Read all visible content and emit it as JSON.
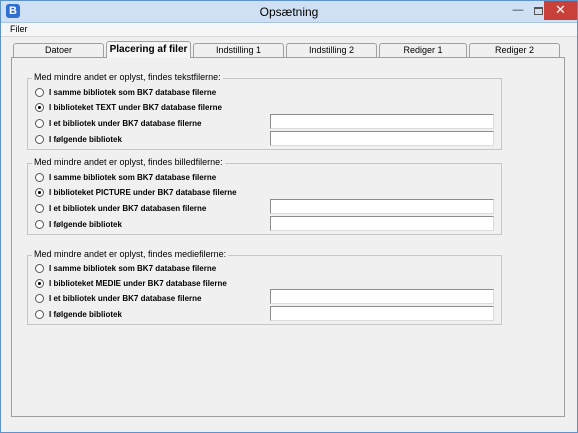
{
  "window": {
    "title": "Opsætning",
    "min_glyph": "—",
    "close_glyph": "✕"
  },
  "menu": [
    {
      "label": "Filer"
    }
  ],
  "tabs": [
    {
      "label": "Datoer",
      "active": false
    },
    {
      "label": "Placering af filer",
      "active": true
    },
    {
      "label": "Indstilling 1",
      "active": false
    },
    {
      "label": "Indstilling 2",
      "active": false
    },
    {
      "label": "Rediger 1",
      "active": false
    },
    {
      "label": "Rediger 2",
      "active": false
    }
  ],
  "groups": [
    {
      "legend": "Med mindre andet er oplyst, findes tekstfilerne:",
      "options": [
        {
          "label": "I samme bibliotek som BK7 database filerne",
          "selected": false
        },
        {
          "label": "I biblioteket TEXT under BK7 database filerne",
          "selected": true
        },
        {
          "label": "I et bibliotek under BK7 database filerne",
          "selected": false,
          "input_value": ""
        },
        {
          "label": "I følgende bibliotek",
          "selected": false,
          "input_value": ""
        }
      ]
    },
    {
      "legend": "Med mindre andet er oplyst, findes billedfilerne:",
      "options": [
        {
          "label": "I samme bibliotek som BK7 database filerne",
          "selected": false
        },
        {
          "label": "I biblioteket PICTURE under BK7 database filerne",
          "selected": true
        },
        {
          "label": "I et bibliotek under BK7 databasen filerne",
          "selected": false,
          "input_value": ""
        },
        {
          "label": "I følgende bibliotek",
          "selected": false,
          "input_value": ""
        }
      ]
    },
    {
      "legend": "Med mindre andet er oplyst, findes mediefilerne:",
      "options": [
        {
          "label": "I samme bibliotek som BK7 database filerne",
          "selected": false
        },
        {
          "label": "I biblioteket MEDIE under BK7 database filerne",
          "selected": true
        },
        {
          "label": "I et bibliotek under BK7 database filerne",
          "selected": false,
          "input_value": ""
        },
        {
          "label": "I følgende bibliotek",
          "selected": false,
          "input_value": ""
        }
      ]
    }
  ]
}
